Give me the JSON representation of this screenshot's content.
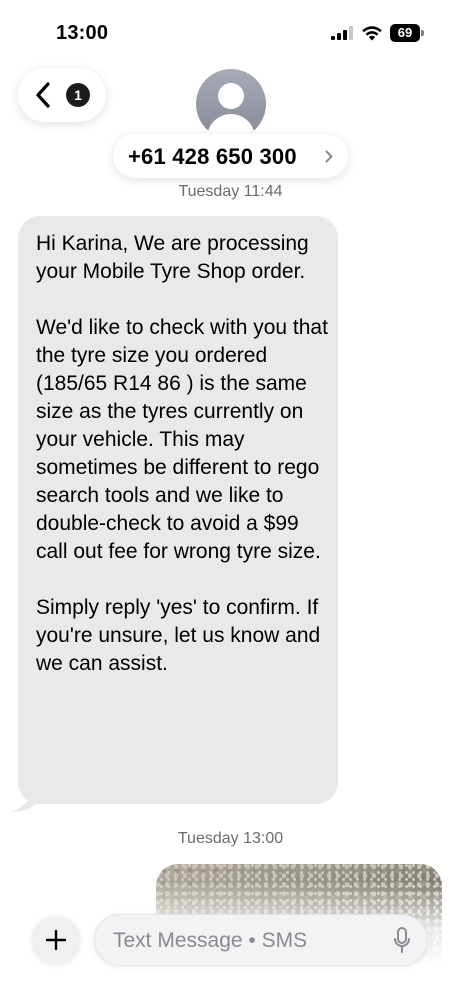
{
  "status_bar": {
    "time": "13:00",
    "battery_level": "69",
    "icons": [
      "signal-icon",
      "wifi-icon",
      "battery-icon"
    ]
  },
  "header": {
    "back_badge_count": "1",
    "contact_name": "+61 428 650 300"
  },
  "conversation": {
    "timestamps": [
      "Tuesday 11:44",
      "Tuesday 13:00"
    ],
    "incoming_message": "Hi Karina, We are processing your Mobile Tyre Shop order.\n\nWe'd like to check with you that the tyre size you ordered (185/65 R14 86 ) is the same size as the tyres currently on your vehicle. This may sometimes be different to rego search tools and we like to double-check to avoid a $99 call out fee for wrong tyre size.\n\nSimply reply 'yes' to confirm. If you're unsure, let us know and we can assist."
  },
  "composer": {
    "placeholder": "Text Message • SMS"
  },
  "colors": {
    "incoming_bubble": "#e9e9eb",
    "timestamp_text": "#6b6b70",
    "background": "#ffffff"
  }
}
